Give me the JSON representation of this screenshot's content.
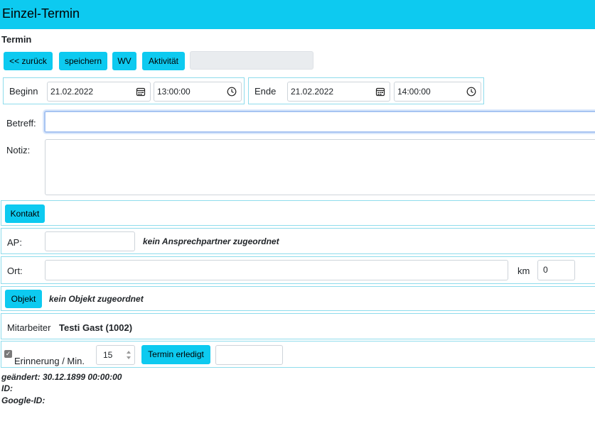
{
  "app": {
    "title": "Einzel-Termin"
  },
  "section": {
    "title": "Termin"
  },
  "toolbar": {
    "back_label": "<< zurück",
    "save_label": "speichern",
    "wv_label": "WV",
    "activity_label": "Aktivität"
  },
  "time": {
    "begin_label": "Beginn",
    "begin_date": "21.02.2022",
    "begin_time": "13:00:00",
    "end_label": "Ende",
    "end_date": "21.02.2022",
    "end_time": "14:00:00"
  },
  "subject": {
    "label": "Betreff:",
    "value": ""
  },
  "note": {
    "label": "Notiz:",
    "value": ""
  },
  "contact": {
    "button_label": "Kontakt"
  },
  "ap": {
    "label": "AP:",
    "value": "",
    "status": "kein Ansprechpartner zugeordnet"
  },
  "location": {
    "label": "Ort:",
    "value": "",
    "km_label": "km",
    "km_value": "0"
  },
  "object": {
    "button_label": "Objekt",
    "status": "kein Objekt zugeordnet"
  },
  "employee": {
    "label": "Mitarbeiter",
    "name": "Testi Gast (1002)"
  },
  "reminder": {
    "checked": true,
    "label": "Erinnerung / Min.",
    "minutes": "15",
    "done_label": "Termin erledigt",
    "done_value": ""
  },
  "footer": {
    "changed": "geändert: 30.12.1899 00:00:00",
    "id": "ID:",
    "google_id": "Google-ID:"
  },
  "colors": {
    "accent": "#0dcaf0",
    "panel_border": "#8fdcec"
  },
  "icons": [
    "calendar-icon",
    "clock-icon",
    "spinner-icon",
    "checkbox-icon"
  ]
}
